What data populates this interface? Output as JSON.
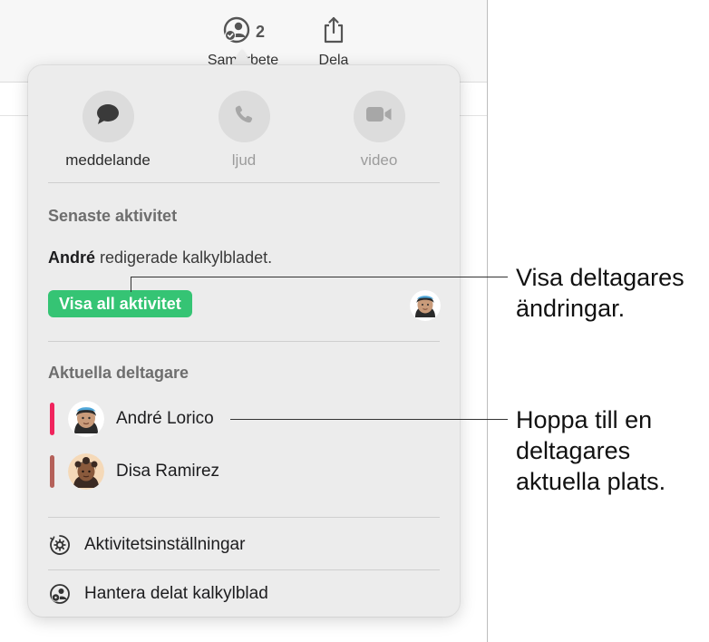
{
  "toolbar": {
    "collaborate": {
      "icon": "collaborate-icon",
      "count": "2",
      "label": "Samarbete"
    },
    "share": {
      "icon": "share-icon",
      "label": "Dela"
    }
  },
  "popover": {
    "communication": [
      {
        "icon": "message-icon",
        "label": "meddelande",
        "enabled": true
      },
      {
        "icon": "phone-icon",
        "label": "ljud",
        "enabled": false
      },
      {
        "icon": "video-camera-icon",
        "label": "video",
        "enabled": false
      }
    ],
    "recent_activity": {
      "title": "Senaste aktivitet",
      "user": "André",
      "text": "redigerade kalkylbladet.",
      "show_all_label": "Visa all aktivitet"
    },
    "participants": {
      "title": "Aktuella deltagare",
      "items": [
        {
          "name": "André Lorico",
          "color": "#f0245d"
        },
        {
          "name": "Disa Ramirez",
          "color": "#b5615a"
        }
      ]
    },
    "menu": [
      {
        "icon": "activity-settings-icon",
        "label": "Aktivitetsinställningar"
      },
      {
        "icon": "manage-shared-icon",
        "label": "Hantera delat kalkylblad"
      }
    ]
  },
  "callouts": {
    "show_changes": "Visa deltagares ändringar.",
    "jump_to": "Hoppa till en deltagares aktuella plats."
  },
  "colors": {
    "accent_green": "#35c474",
    "popover_bg": "#ececec"
  }
}
